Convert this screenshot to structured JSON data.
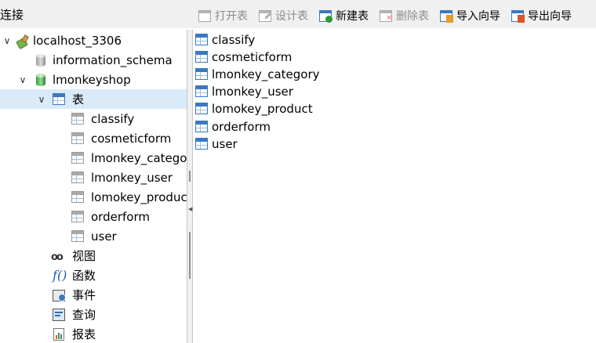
{
  "sidebar": {
    "title": "连接",
    "tree": {
      "connection": "localhost_3306",
      "db_information_schema": "information_schema",
      "db_current": "lmonkeyshop",
      "tables_group": "表",
      "tables": [
        "classify",
        "cosmeticform",
        "lmonkey_category",
        "lmonkey_user",
        "lomokey_product",
        "orderform",
        "user"
      ],
      "views_group": "视图",
      "functions_group": "函数",
      "events_group": "事件",
      "queries_group": "查询",
      "reports_group": "报表"
    }
  },
  "toolbar": {
    "open_table": "打开表",
    "design_table": "设计表",
    "new_table": "新建表",
    "delete_table": "删除表",
    "import_wizard": "导入向导",
    "export_wizard": "导出向导"
  },
  "content": {
    "tables": [
      "classify",
      "cosmeticform",
      "lmonkey_category",
      "lmonkey_user",
      "lomokey_product",
      "orderform",
      "user"
    ]
  },
  "icons": {
    "connection": "plug-icon",
    "database": "database-icon",
    "table": "table-icon",
    "view": "glasses-icon",
    "function": "function-icon",
    "event": "event-icon",
    "query": "query-icon",
    "report": "report-icon"
  },
  "colors": {
    "selection": "#d9ebf9",
    "panel_bg": "#f0f0f0",
    "table_icon": "#3a78bf",
    "open_db": "#3a9a3a"
  }
}
